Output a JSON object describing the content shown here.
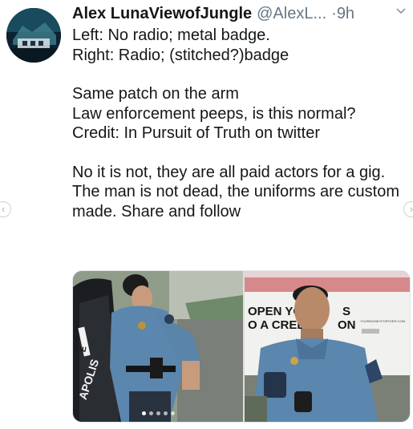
{
  "tweet": {
    "display_name": "Alex LunaViewofJungle",
    "handle": "@AlexL...",
    "separator": "·",
    "time": "9h",
    "paragraphs": [
      "Left: No radio; metal badge.\nRight: Radio; (stitched?)badge",
      "Same patch on the arm\nLaw enforcement peeps, is this normal?\nCredit: In Pursuit of Truth on twitter",
      "No it is not, they are all paid actors for a gig. The man is not dead, the uniforms are custom made. Share and follow"
    ]
  },
  "media": {
    "left_sign_text": "APOLIS",
    "left_sign_letter": "E",
    "right_sign_line1": "OPEN YO",
    "right_sign_line1b": "S",
    "right_sign_line2": "O A CRED",
    "right_sign_line2b": "ON",
    "right_small_text": "YOURMONEYFORTHER.COM"
  },
  "carousel": {
    "count": 5,
    "active": 0
  },
  "icons": {
    "caret": "chevron-down-icon",
    "prev": "chevron-left-icon",
    "next": "chevron-right-icon"
  },
  "colors": {
    "text": "#14171a",
    "muted": "#657786",
    "uniform": "#5b86ad"
  }
}
